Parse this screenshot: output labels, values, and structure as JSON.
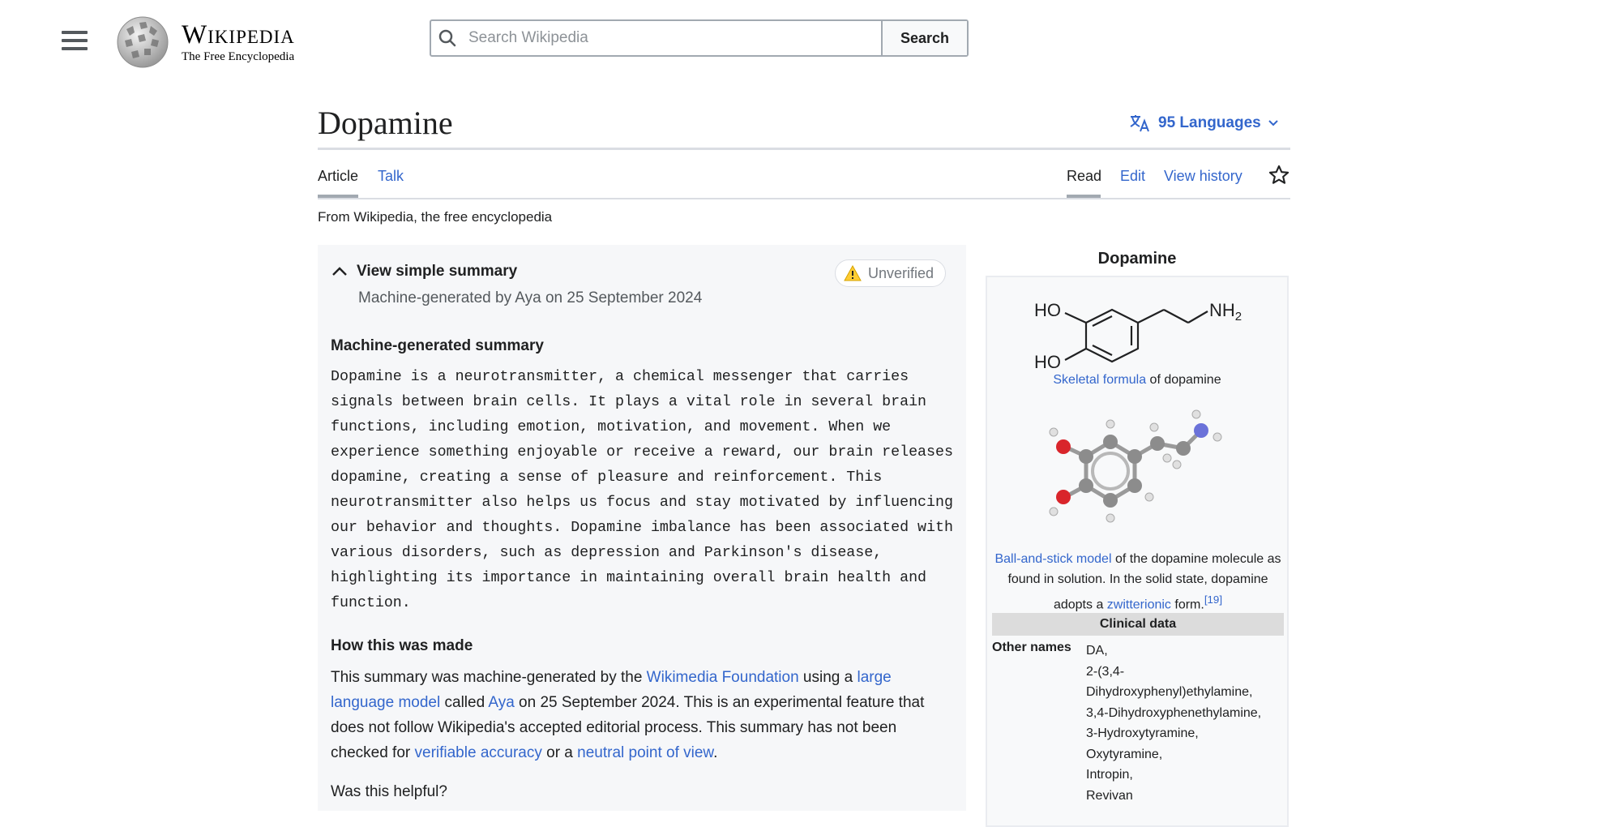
{
  "header": {
    "logo_word": "Wikipedia",
    "logo_tagline": "The Free Encyclopedia",
    "search_placeholder": "Search Wikipedia",
    "search_button": "Search"
  },
  "article": {
    "title": "Dopamine",
    "languages": "95 Languages",
    "tabs_left": [
      "Article",
      "Talk"
    ],
    "tabs_right": [
      "Read",
      "Edit",
      "View history"
    ],
    "tagline": "From Wikipedia, the free encyclopedia"
  },
  "summary": {
    "toggle_label": "View simple summary",
    "badge": "Unverified",
    "byline": "Machine-generated by Aya on 25 September 2024",
    "heading": "Machine-generated summary",
    "text": "Dopamine is a neurotransmitter, a chemical messenger that carries signals between brain cells. It plays a vital role in several brain functions, including emotion, motivation, and movement. When we experience something enjoyable or receive a reward, our brain releases dopamine, creating a sense of pleasure and reinforcement. This neurotransmitter also helps us focus and stay motivated by influencing our behavior and thoughts. Dopamine imbalance has been associated with various disorders, such as depression and Parkinson's disease, highlighting its importance in maintaining overall brain health and function.",
    "how_heading": "How this was made",
    "how": {
      "t1": "This summary was machine-generated by the ",
      "l1": "Wikimedia Foundation",
      "t2": " using a ",
      "l2": "large language model",
      "t3": " called ",
      "l3": "Aya",
      "t4": " on 25 September 2024. This is an experimental feature that does not follow Wikipedia's accepted editorial process. This summary has not been checked for ",
      "l4": "verifiable accuracy",
      "t5": " or a ",
      "l5": "neutral point of view",
      "t6": "."
    },
    "helpful": "Was this helpful?"
  },
  "infobox": {
    "title": "Dopamine",
    "formula_labels": {
      "ho1": "HO",
      "ho2": "HO",
      "nh2": "NH",
      "nh2_sub": "2"
    },
    "cap1_link": "Skeletal formula",
    "cap1_rest": " of dopamine",
    "cap2_link1": "Ball-and-stick model",
    "cap2_text1": " of the dopamine molecule as found in solution. In the solid state, dopamine adopts a ",
    "cap2_link2": "zwitterionic",
    "cap2_text2": " form.",
    "cap2_ref": "[19]",
    "section": "Clinical data",
    "other_names_label": "Other names",
    "other_names": [
      "DA,",
      "2-(3,4-",
      "Dihydroxyphenyl)ethylamine,",
      "3,4-Dihydroxyphenethylamine,",
      "3-Hydroxytyramine,",
      "Oxytyramine,",
      "Intropin,",
      "Revivan"
    ]
  },
  "colors": {
    "link": "#3366cc",
    "panel_bg": "#f6f7f9",
    "warning": "#fc3"
  },
  "icons": [
    "menu-icon",
    "wikipedia-globe-icon",
    "search-icon",
    "translate-icon",
    "chevron-down-icon",
    "star-icon",
    "chevron-up-icon",
    "warning-icon"
  ]
}
